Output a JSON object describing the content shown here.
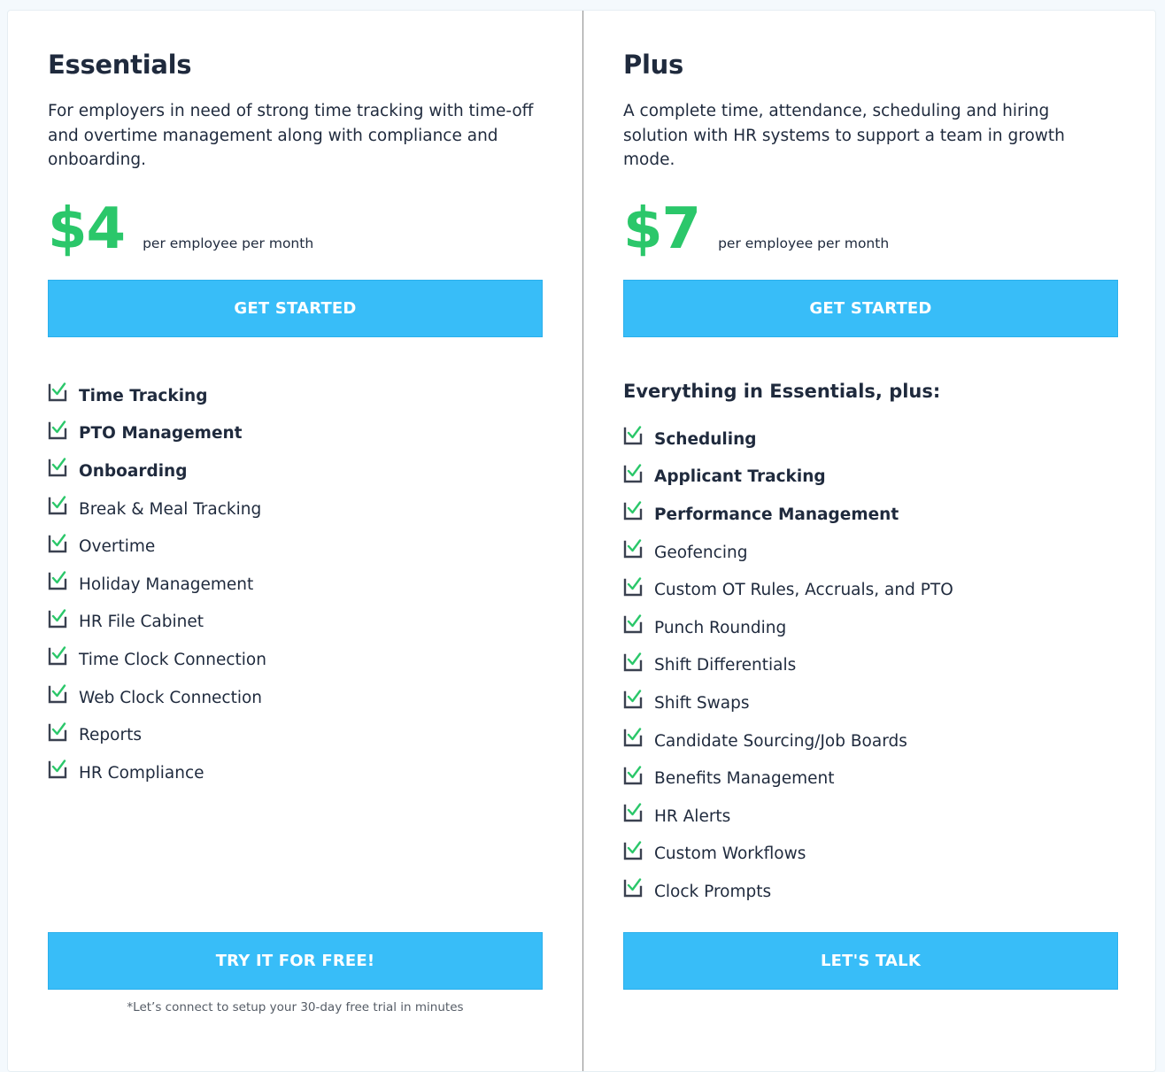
{
  "colors": {
    "accent_button": "#38bdf8",
    "price_green": "#2bc76a",
    "text_dark": "#1f2a3d",
    "check_green": "#2bc76a",
    "check_box": "#3a4150"
  },
  "plans": [
    {
      "title": "Essentials",
      "description": "For employers in need of strong time tracking with time-off and overtime management along with compliance and onboarding.",
      "price": "$4",
      "price_unit": "per employee per month",
      "primary_button": "GET STARTED",
      "features": [
        {
          "label": "Time Tracking",
          "bold": true,
          "icon": "checkbox-checked-icon"
        },
        {
          "label": "PTO Management",
          "bold": true,
          "icon": "checkbox-checked-icon"
        },
        {
          "label": "Onboarding",
          "bold": true,
          "icon": "checkbox-checked-icon"
        },
        {
          "label": "Break & Meal Tracking",
          "bold": false,
          "icon": "checkbox-checked-icon"
        },
        {
          "label": "Overtime",
          "bold": false,
          "icon": "checkbox-checked-icon"
        },
        {
          "label": "Holiday Management",
          "bold": false,
          "icon": "checkbox-checked-icon"
        },
        {
          "label": "HR File Cabinet",
          "bold": false,
          "icon": "checkbox-checked-icon"
        },
        {
          "label": "Time Clock Connection",
          "bold": false,
          "icon": "checkbox-checked-icon"
        },
        {
          "label": "Web Clock Connection",
          "bold": false,
          "icon": "checkbox-checked-icon"
        },
        {
          "label": "Reports",
          "bold": false,
          "icon": "checkbox-checked-icon"
        },
        {
          "label": "HR Compliance",
          "bold": false,
          "icon": "checkbox-checked-icon"
        }
      ],
      "secondary_button": "TRY IT FOR FREE!",
      "footnote": "*Let’s connect to setup your 30-day free trial in minutes"
    },
    {
      "title": "Plus",
      "description": "A complete time, attendance, scheduling and hiring solution with HR systems to support a team in growth mode.",
      "price": "$7",
      "price_unit": "per employee per month",
      "primary_button": "GET STARTED",
      "features_heading": "Everything in Essentials, plus:",
      "features": [
        {
          "label": "Scheduling",
          "bold": true,
          "icon": "checkbox-checked-icon"
        },
        {
          "label": "Applicant Tracking",
          "bold": true,
          "icon": "checkbox-checked-icon"
        },
        {
          "label": "Performance Management",
          "bold": true,
          "icon": "checkbox-checked-icon"
        },
        {
          "label": "Geofencing",
          "bold": false,
          "icon": "checkbox-checked-icon"
        },
        {
          "label": "Custom OT Rules, Accruals, and PTO",
          "bold": false,
          "icon": "checkbox-checked-icon"
        },
        {
          "label": "Punch Rounding",
          "bold": false,
          "icon": "checkbox-checked-icon"
        },
        {
          "label": "Shift Differentials",
          "bold": false,
          "icon": "checkbox-checked-icon"
        },
        {
          "label": "Shift Swaps",
          "bold": false,
          "icon": "checkbox-checked-icon"
        },
        {
          "label": "Candidate Sourcing/Job Boards",
          "bold": false,
          "icon": "checkbox-checked-icon"
        },
        {
          "label": "Benefits Management",
          "bold": false,
          "icon": "checkbox-checked-icon"
        },
        {
          "label": "HR Alerts",
          "bold": false,
          "icon": "checkbox-checked-icon"
        },
        {
          "label": "Custom Workflows",
          "bold": false,
          "icon": "checkbox-checked-icon"
        },
        {
          "label": "Clock Prompts",
          "bold": false,
          "icon": "checkbox-checked-icon"
        }
      ],
      "secondary_button": "LET'S TALK"
    }
  ]
}
